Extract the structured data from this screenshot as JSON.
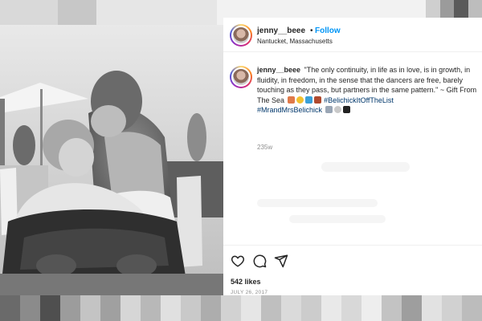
{
  "post": {
    "username": "jenny__beee",
    "separator": "•",
    "follow_label": "Follow",
    "location": "Nantucket, Massachusetts",
    "caption": {
      "username": "jenny__beee",
      "text": "\"The only continuity, in life as in love, is in growth, in fluidity, in freedom, in the sense that the dancers are free, barely touching as they pass, but partners in the same pattern.\" ~ Gift From The Sea",
      "hashtag1": "#BelichickItOffTheList",
      "hashtag2": "#MrandMrsBelichick"
    },
    "time_ago": "235w",
    "likes": "542 likes",
    "date": "JULY 26, 2017"
  },
  "icons": {
    "like": "heart-icon",
    "comment": "comment-icon",
    "share": "share-icon"
  },
  "colors": {
    "follow": "#0095f6",
    "hashtag": "#00376b",
    "muted": "#8e8e8e",
    "text": "#262626"
  }
}
